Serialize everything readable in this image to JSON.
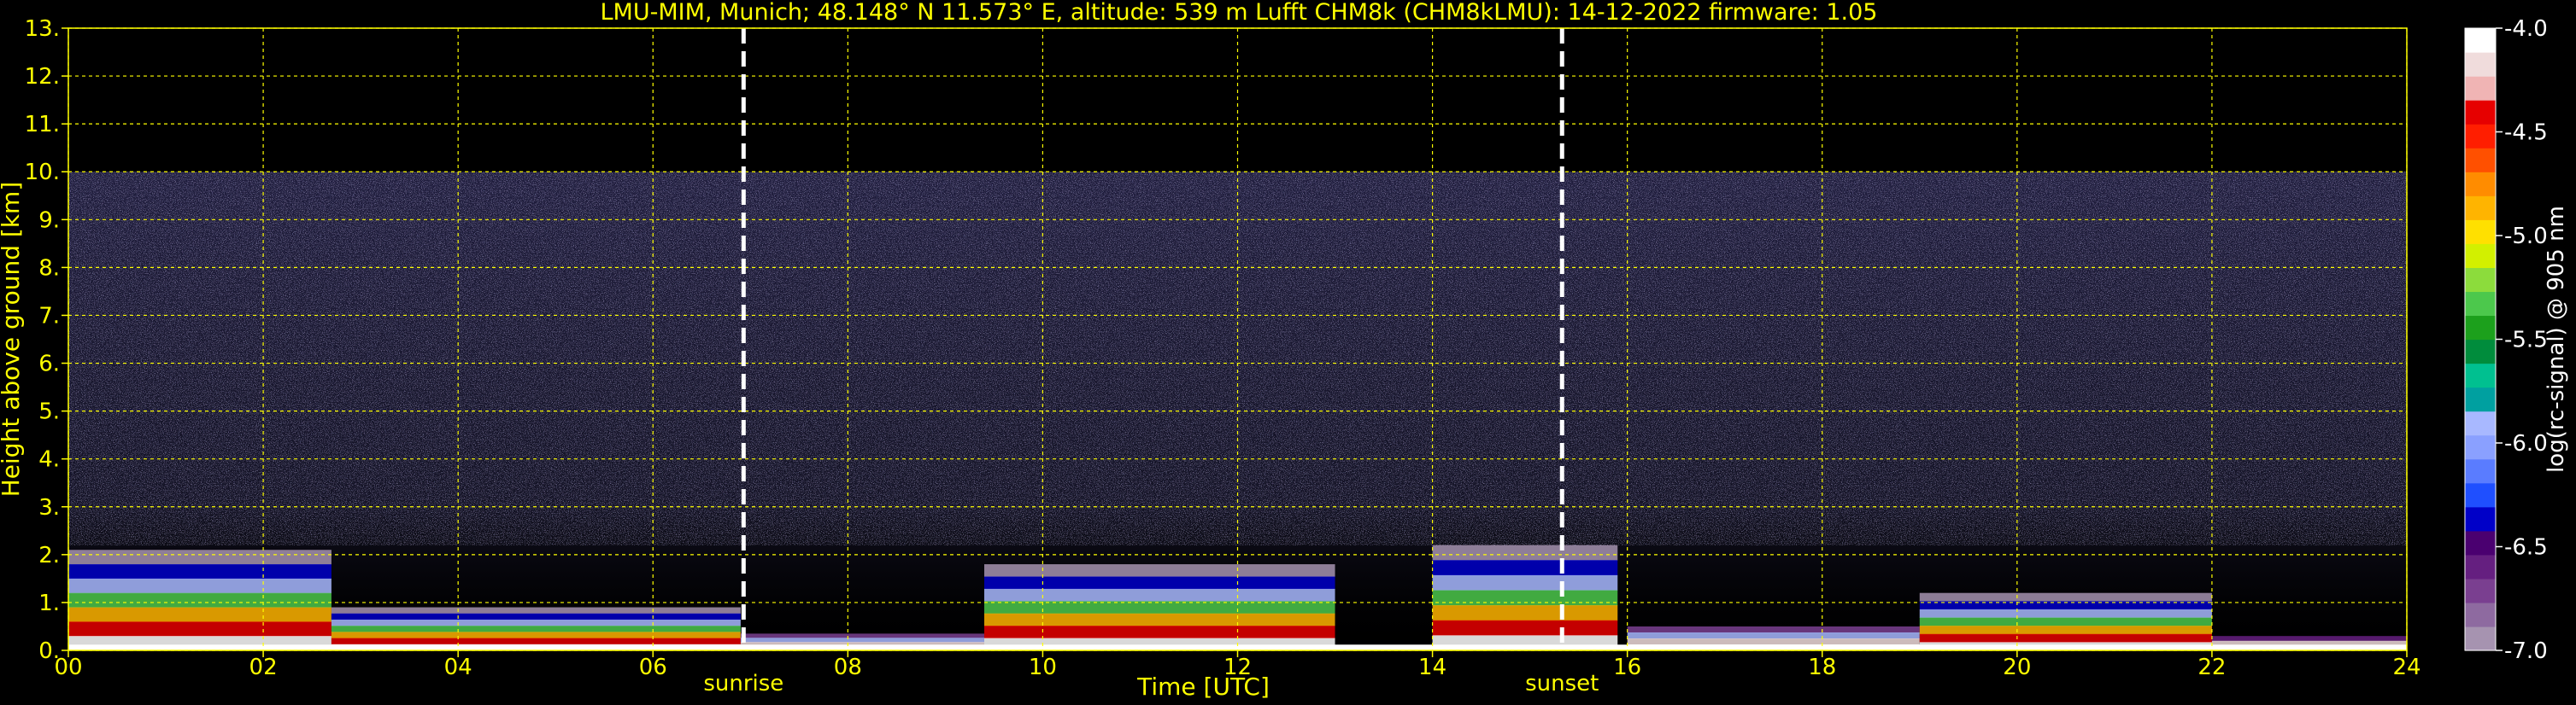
{
  "chart_data": {
    "type": "heatmap",
    "title": "LMU-MIM, Munich; 48.148° N 11.573° E, altitude: 539 m    Lufft CHM8k (CHM8kLMU): 14-12-2022    firmware: 1.05",
    "xlabel": "Time [UTC]",
    "ylabel": "Height above ground [km]",
    "xlim": [
      0,
      24
    ],
    "ylim": [
      0,
      13
    ],
    "x_ticks": [
      "00",
      "02",
      "04",
      "06",
      "08",
      "10",
      "12",
      "14",
      "16",
      "18",
      "20",
      "22",
      "24"
    ],
    "y_ticks": [
      "0.",
      "1.",
      "2.",
      "3.",
      "4.",
      "5.",
      "6.",
      "7.",
      "8.",
      "9.",
      "10.",
      "11.",
      "12.",
      "13."
    ],
    "grid": true,
    "signal_top_km": 10.0,
    "annotations": [
      {
        "label": "sunrise",
        "x": 6.93
      },
      {
        "label": "sunset",
        "x": 15.33
      }
    ],
    "colorbar": {
      "label": "log(rc-signal) @ 905 nm",
      "range": [
        -7.0,
        -4.0
      ],
      "ticks": [
        "-4.0",
        "-4.5",
        "-5.0",
        "-5.5",
        "-6.0",
        "-6.5",
        "-7.0"
      ],
      "colors": [
        "#a693b0",
        "#8e6aa0",
        "#7a3f90",
        "#651f80",
        "#4a0070",
        "#0000c8",
        "#1f4fff",
        "#5a7cff",
        "#8aa0ff",
        "#a8b8ff",
        "#00a0a0",
        "#00c090",
        "#008c3c",
        "#1ca01c",
        "#4cc84c",
        "#8cdc3c",
        "#d2f000",
        "#ffe000",
        "#ffb400",
        "#ff8c00",
        "#ff5000",
        "#ff1e00",
        "#e60000",
        "#f0b4b4",
        "#f0dcdc",
        "#ffffff"
      ]
    },
    "layers": [
      {
        "x0": 0.0,
        "x1": 2.7,
        "top": 2.1,
        "intensity": "high"
      },
      {
        "x0": 2.7,
        "x1": 6.9,
        "top": 0.9,
        "intensity": "high"
      },
      {
        "x0": 6.9,
        "x1": 9.4,
        "top": 0.35,
        "intensity": "medium"
      },
      {
        "x0": 9.4,
        "x1": 13.0,
        "top": 1.8,
        "intensity": "high"
      },
      {
        "x0": 14.0,
        "x1": 15.9,
        "top": 2.2,
        "intensity": "high"
      },
      {
        "x0": 16.0,
        "x1": 19.0,
        "top": 0.5,
        "intensity": "medium"
      },
      {
        "x0": 19.0,
        "x1": 22.0,
        "top": 1.2,
        "intensity": "high"
      },
      {
        "x0": 22.0,
        "x1": 24.0,
        "top": 0.3,
        "intensity": "low"
      }
    ]
  }
}
